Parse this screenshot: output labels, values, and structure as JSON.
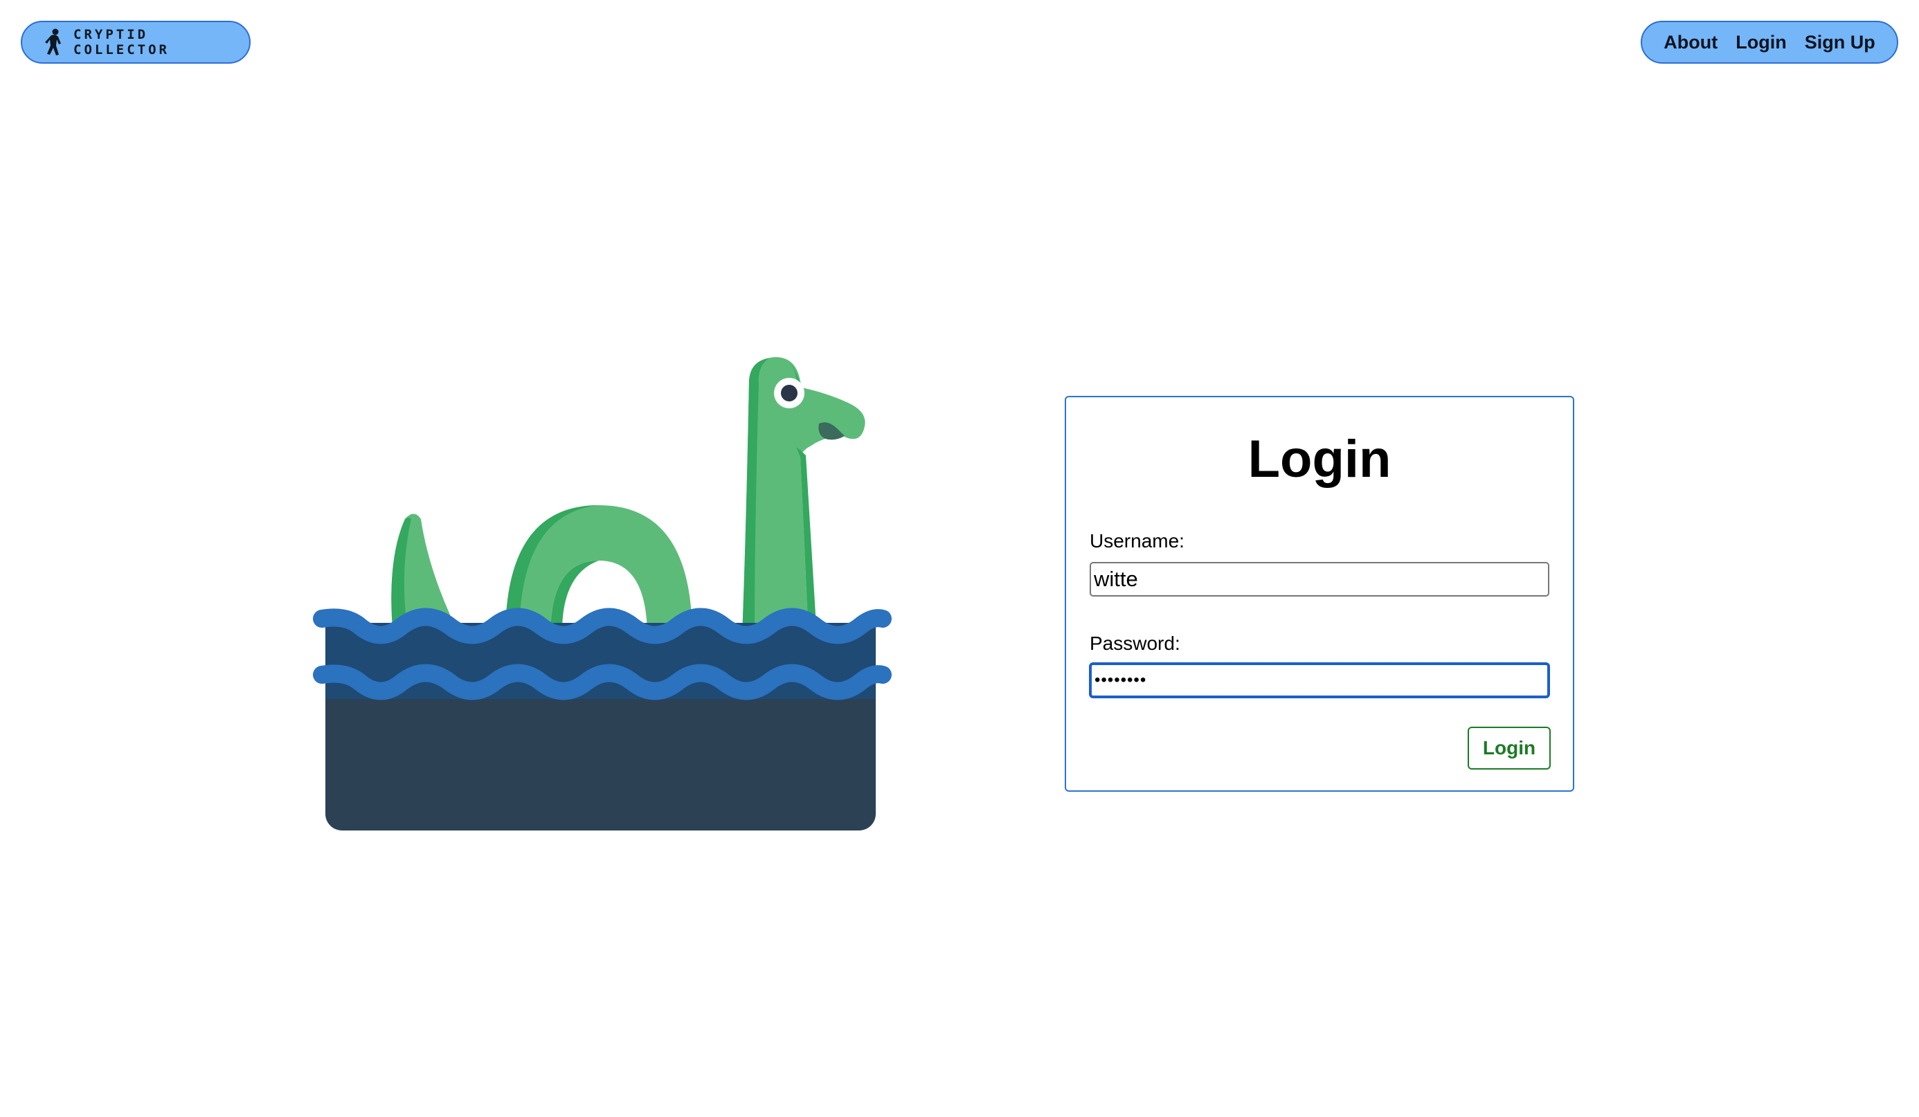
{
  "header": {
    "logo_text": "CRYPTID COLLECTOR",
    "logo_icon": "bigfoot-icon",
    "nav": {
      "about": "About",
      "login": "Login",
      "signup": "Sign Up"
    }
  },
  "illustration": {
    "name": "loch-ness-monster"
  },
  "login_form": {
    "title": "Login",
    "username_label": "Username:",
    "username_value": "witte",
    "password_label": "Password:",
    "password_value": "••••••••",
    "submit_label": "Login"
  },
  "colors": {
    "pill_bg": "#74b6f7",
    "pill_border": "#2d6ed6",
    "card_border": "#2b73d6",
    "submit_green": "#1c7b25",
    "nessie_green": "#5dbb7a",
    "nessie_dark_green": "#33a85e",
    "water_dark": "#2d4155",
    "water_mid": "#1e4a73",
    "wave_blue": "#2b72bf"
  }
}
